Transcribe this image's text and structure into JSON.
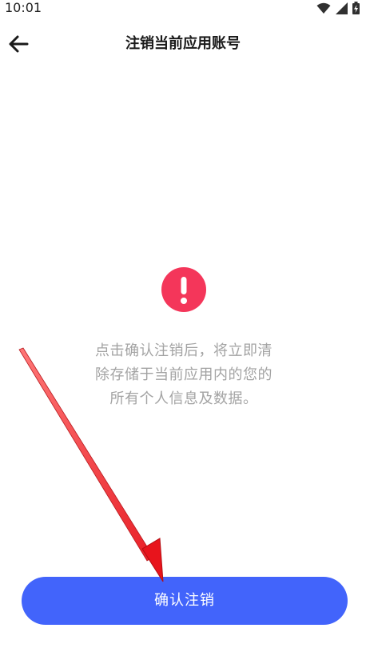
{
  "status_bar": {
    "time": "10:01",
    "icons": [
      "wifi-icon",
      "signal-icon",
      "battery-charging-icon"
    ]
  },
  "header": {
    "back_icon": "arrow-left-icon",
    "title": "注销当前应用账号"
  },
  "main": {
    "warning_icon": "exclamation-circle-icon",
    "warning_color": "#f4365a",
    "message": "点击确认注销后，将立即清\n除存储于当前应用内的您的\n所有个人信息及数据。"
  },
  "footer": {
    "confirm_label": "确认注销",
    "button_color": "#4264fb"
  },
  "annotation": {
    "type": "red-arrow",
    "color": "#e8141c"
  }
}
